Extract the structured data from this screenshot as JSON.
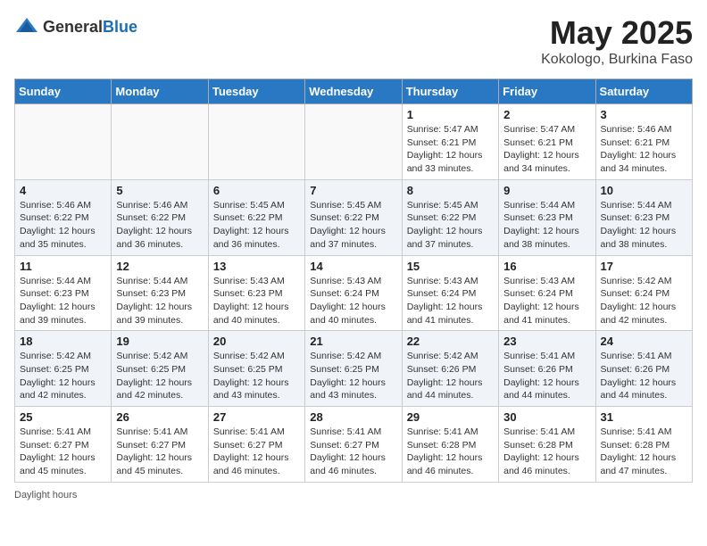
{
  "header": {
    "logo_general": "General",
    "logo_blue": "Blue",
    "title": "May 2025",
    "location": "Kokologo, Burkina Faso"
  },
  "days_of_week": [
    "Sunday",
    "Monday",
    "Tuesday",
    "Wednesday",
    "Thursday",
    "Friday",
    "Saturday"
  ],
  "footer": "Daylight hours",
  "weeks": [
    [
      {
        "day": "",
        "info": ""
      },
      {
        "day": "",
        "info": ""
      },
      {
        "day": "",
        "info": ""
      },
      {
        "day": "",
        "info": ""
      },
      {
        "day": "1",
        "info": "Sunrise: 5:47 AM\nSunset: 6:21 PM\nDaylight: 12 hours\nand 33 minutes."
      },
      {
        "day": "2",
        "info": "Sunrise: 5:47 AM\nSunset: 6:21 PM\nDaylight: 12 hours\nand 34 minutes."
      },
      {
        "day": "3",
        "info": "Sunrise: 5:46 AM\nSunset: 6:21 PM\nDaylight: 12 hours\nand 34 minutes."
      }
    ],
    [
      {
        "day": "4",
        "info": "Sunrise: 5:46 AM\nSunset: 6:22 PM\nDaylight: 12 hours\nand 35 minutes."
      },
      {
        "day": "5",
        "info": "Sunrise: 5:46 AM\nSunset: 6:22 PM\nDaylight: 12 hours\nand 36 minutes."
      },
      {
        "day": "6",
        "info": "Sunrise: 5:45 AM\nSunset: 6:22 PM\nDaylight: 12 hours\nand 36 minutes."
      },
      {
        "day": "7",
        "info": "Sunrise: 5:45 AM\nSunset: 6:22 PM\nDaylight: 12 hours\nand 37 minutes."
      },
      {
        "day": "8",
        "info": "Sunrise: 5:45 AM\nSunset: 6:22 PM\nDaylight: 12 hours\nand 37 minutes."
      },
      {
        "day": "9",
        "info": "Sunrise: 5:44 AM\nSunset: 6:23 PM\nDaylight: 12 hours\nand 38 minutes."
      },
      {
        "day": "10",
        "info": "Sunrise: 5:44 AM\nSunset: 6:23 PM\nDaylight: 12 hours\nand 38 minutes."
      }
    ],
    [
      {
        "day": "11",
        "info": "Sunrise: 5:44 AM\nSunset: 6:23 PM\nDaylight: 12 hours\nand 39 minutes."
      },
      {
        "day": "12",
        "info": "Sunrise: 5:44 AM\nSunset: 6:23 PM\nDaylight: 12 hours\nand 39 minutes."
      },
      {
        "day": "13",
        "info": "Sunrise: 5:43 AM\nSunset: 6:23 PM\nDaylight: 12 hours\nand 40 minutes."
      },
      {
        "day": "14",
        "info": "Sunrise: 5:43 AM\nSunset: 6:24 PM\nDaylight: 12 hours\nand 40 minutes."
      },
      {
        "day": "15",
        "info": "Sunrise: 5:43 AM\nSunset: 6:24 PM\nDaylight: 12 hours\nand 41 minutes."
      },
      {
        "day": "16",
        "info": "Sunrise: 5:43 AM\nSunset: 6:24 PM\nDaylight: 12 hours\nand 41 minutes."
      },
      {
        "day": "17",
        "info": "Sunrise: 5:42 AM\nSunset: 6:24 PM\nDaylight: 12 hours\nand 42 minutes."
      }
    ],
    [
      {
        "day": "18",
        "info": "Sunrise: 5:42 AM\nSunset: 6:25 PM\nDaylight: 12 hours\nand 42 minutes."
      },
      {
        "day": "19",
        "info": "Sunrise: 5:42 AM\nSunset: 6:25 PM\nDaylight: 12 hours\nand 42 minutes."
      },
      {
        "day": "20",
        "info": "Sunrise: 5:42 AM\nSunset: 6:25 PM\nDaylight: 12 hours\nand 43 minutes."
      },
      {
        "day": "21",
        "info": "Sunrise: 5:42 AM\nSunset: 6:25 PM\nDaylight: 12 hours\nand 43 minutes."
      },
      {
        "day": "22",
        "info": "Sunrise: 5:42 AM\nSunset: 6:26 PM\nDaylight: 12 hours\nand 44 minutes."
      },
      {
        "day": "23",
        "info": "Sunrise: 5:41 AM\nSunset: 6:26 PM\nDaylight: 12 hours\nand 44 minutes."
      },
      {
        "day": "24",
        "info": "Sunrise: 5:41 AM\nSunset: 6:26 PM\nDaylight: 12 hours\nand 44 minutes."
      }
    ],
    [
      {
        "day": "25",
        "info": "Sunrise: 5:41 AM\nSunset: 6:27 PM\nDaylight: 12 hours\nand 45 minutes."
      },
      {
        "day": "26",
        "info": "Sunrise: 5:41 AM\nSunset: 6:27 PM\nDaylight: 12 hours\nand 45 minutes."
      },
      {
        "day": "27",
        "info": "Sunrise: 5:41 AM\nSunset: 6:27 PM\nDaylight: 12 hours\nand 46 minutes."
      },
      {
        "day": "28",
        "info": "Sunrise: 5:41 AM\nSunset: 6:27 PM\nDaylight: 12 hours\nand 46 minutes."
      },
      {
        "day": "29",
        "info": "Sunrise: 5:41 AM\nSunset: 6:28 PM\nDaylight: 12 hours\nand 46 minutes."
      },
      {
        "day": "30",
        "info": "Sunrise: 5:41 AM\nSunset: 6:28 PM\nDaylight: 12 hours\nand 46 minutes."
      },
      {
        "day": "31",
        "info": "Sunrise: 5:41 AM\nSunset: 6:28 PM\nDaylight: 12 hours\nand 47 minutes."
      }
    ]
  ]
}
